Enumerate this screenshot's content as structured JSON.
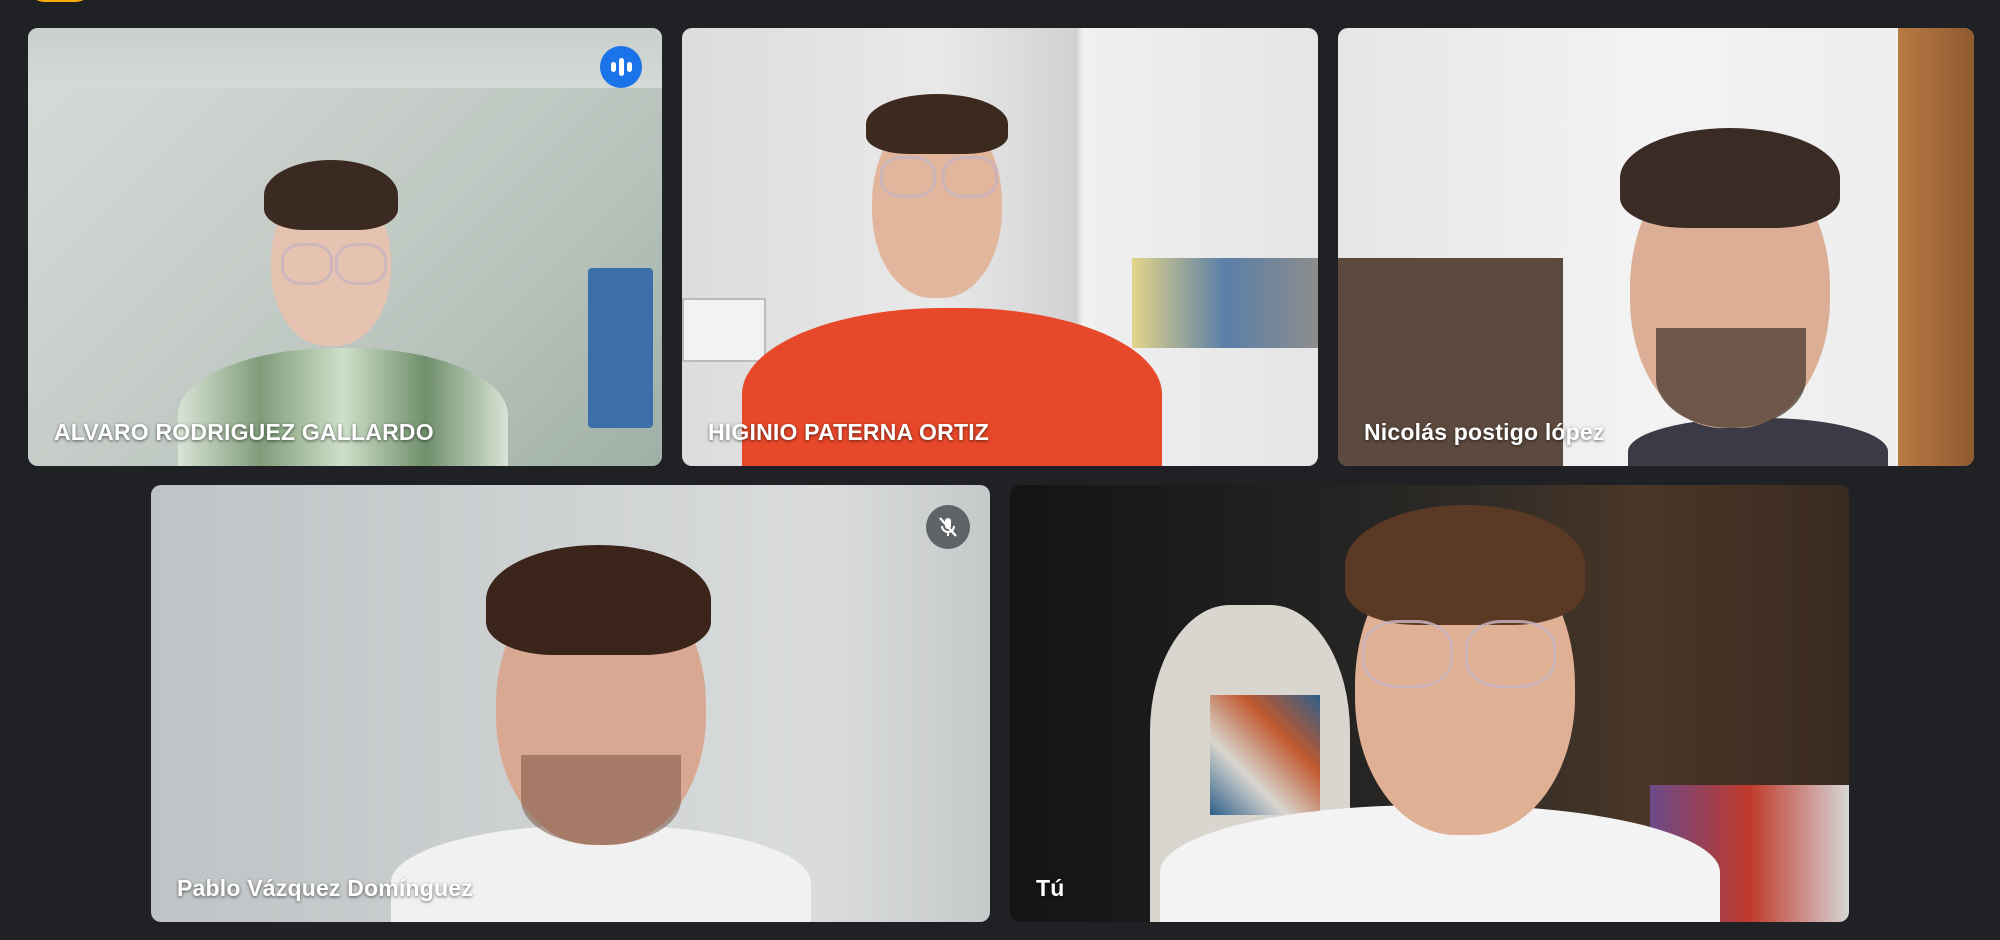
{
  "participants": [
    {
      "name": "ALVARO RODRIGUEZ GALLARDO",
      "speaking": true,
      "muted": false
    },
    {
      "name": "HIGINIO PATERNA ORTIZ",
      "speaking": false,
      "muted": false
    },
    {
      "name": "Nicolás postigo lópez",
      "speaking": false,
      "muted": false
    },
    {
      "name": "Pablo Vázquez Domínguez",
      "speaking": false,
      "muted": true
    },
    {
      "name": "Tú",
      "speaking": false,
      "muted": false
    }
  ],
  "icons": {
    "speaking": "audio-level-icon",
    "muted": "mic-off-icon"
  },
  "colors": {
    "background": "#202124",
    "active_outline": "#8ab4f8",
    "speaking_badge": "#1a73e8",
    "top_badge": "#f9ab00"
  }
}
